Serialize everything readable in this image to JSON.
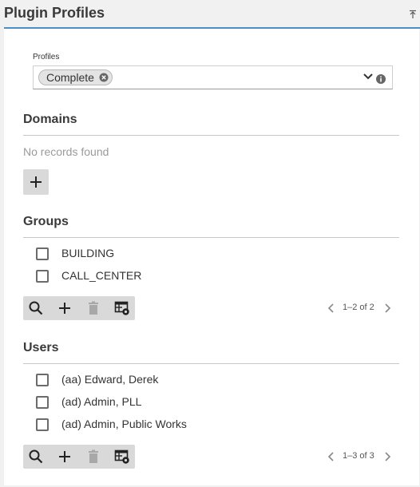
{
  "panel": {
    "title": "Plugin Profiles"
  },
  "profiles": {
    "label": "Profiles",
    "selected_chip": "Complete"
  },
  "domains": {
    "title": "Domains",
    "empty_text": "No records found"
  },
  "groups": {
    "title": "Groups",
    "items": [
      "BUILDING",
      "CALL_CENTER"
    ],
    "pager": {
      "range": "1–2 of 2"
    }
  },
  "users": {
    "title": "Users",
    "items": [
      "(aa) Edward, Derek",
      "(ad) Admin, PLL",
      "(ad) Admin, Public Works"
    ],
    "pager": {
      "range": "1–3 of 3"
    }
  },
  "colors": {
    "accent": "#4a90c4",
    "toolbar_bg": "#d9d9d9",
    "disabled_icon": "#a8a8a8"
  }
}
